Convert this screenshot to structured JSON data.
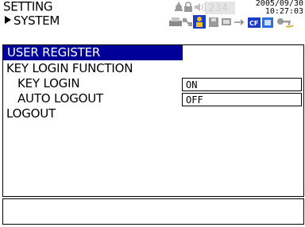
{
  "header": {
    "title": "SETTING",
    "subtitle": "SYSTEM",
    "date": "2005/09/30",
    "time": "10:27:03",
    "lcd_digits": "1234",
    "icons": [
      "alarm-bell-icon",
      "lock-icon",
      "speaker-icon",
      "digit-display",
      "printer-icon",
      "network-icon",
      "user-icon",
      "disk-icon",
      "comm-icon",
      "cf-card-icon",
      "memory-icon",
      "key-icon"
    ]
  },
  "menu": {
    "items": [
      {
        "label": "USER REGISTER",
        "selected": true
      },
      {
        "label": "KEY LOGIN FUNCTION",
        "selected": false
      },
      {
        "label": "KEY LOGIN",
        "value": "ON",
        "selected": false
      },
      {
        "label": "AUTO LOGOUT",
        "value": "OFF",
        "selected": false
      },
      {
        "label": "LOGOUT",
        "selected": false
      }
    ]
  },
  "colors": {
    "selection": "#000099",
    "cf_badge": "#1a3cc8"
  },
  "message": ""
}
